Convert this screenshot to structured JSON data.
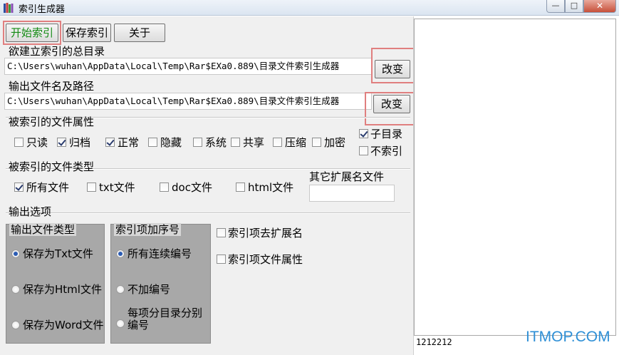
{
  "window": {
    "title": "索引生成器",
    "controls": {
      "minimize": "—",
      "maximize": "□",
      "close": "✕"
    }
  },
  "toolbar": {
    "start_label": "开始索引",
    "save_label": "保存索引",
    "about_label": "关于"
  },
  "root_dir": {
    "label": "欲建立索引的总目录",
    "value": "C:\\Users\\wuhan\\AppData\\Local\\Temp\\Rar$EXa0.889\\目录文件索引生成器",
    "change_label": "改变"
  },
  "output_path": {
    "label": "输出文件名及路径",
    "value": "C:\\Users\\wuhan\\AppData\\Local\\Temp\\Rar$EXa0.889\\目录文件索引生成器",
    "change_label": "改变"
  },
  "attributes": {
    "label": "被索引的文件属性",
    "items": [
      {
        "label": "只读",
        "checked": false
      },
      {
        "label": "归档",
        "checked": true
      },
      {
        "label": "正常",
        "checked": true
      },
      {
        "label": "隐藏",
        "checked": false
      },
      {
        "label": "系统",
        "checked": false
      },
      {
        "label": "共享",
        "checked": false
      },
      {
        "label": "压缩",
        "checked": false
      },
      {
        "label": "加密",
        "checked": false
      }
    ],
    "subdir": {
      "label": "子目录",
      "checked": true
    },
    "no_index": {
      "label": "不索引",
      "checked": false
    }
  },
  "file_types": {
    "label": "被索引的文件类型",
    "items": [
      {
        "label": "所有文件",
        "checked": true
      },
      {
        "label": "txt文件",
        "checked": false
      },
      {
        "label": "doc文件",
        "checked": false
      },
      {
        "label": "html文件",
        "checked": false
      }
    ],
    "other_ext_label": "其它扩展名文件",
    "other_ext_value": ""
  },
  "output_options": {
    "label": "输出选项",
    "file_type_group": {
      "title": "输出文件类型",
      "options": [
        "保存为Txt文件",
        "保存为Html文件",
        "保存为Word文件"
      ],
      "selected_index": 0
    },
    "numbering_group": {
      "title": "索引项加序号",
      "options": [
        "所有连续编号",
        "不加编号",
        "每项分目录分别编号"
      ],
      "selected_index": 0
    },
    "strip_ext": {
      "label": "索引项去扩展名",
      "checked": false
    },
    "item_attrs": {
      "label": "索引项文件属性",
      "checked": false
    }
  },
  "status": {
    "text": "1212212"
  },
  "watermark": "ITMOP.COM",
  "colors": {
    "highlight_border": "#e07f7f",
    "start_text": "#138a13",
    "groupbox_bg": "#a8a8a8",
    "watermark": "#2e8fd6"
  }
}
